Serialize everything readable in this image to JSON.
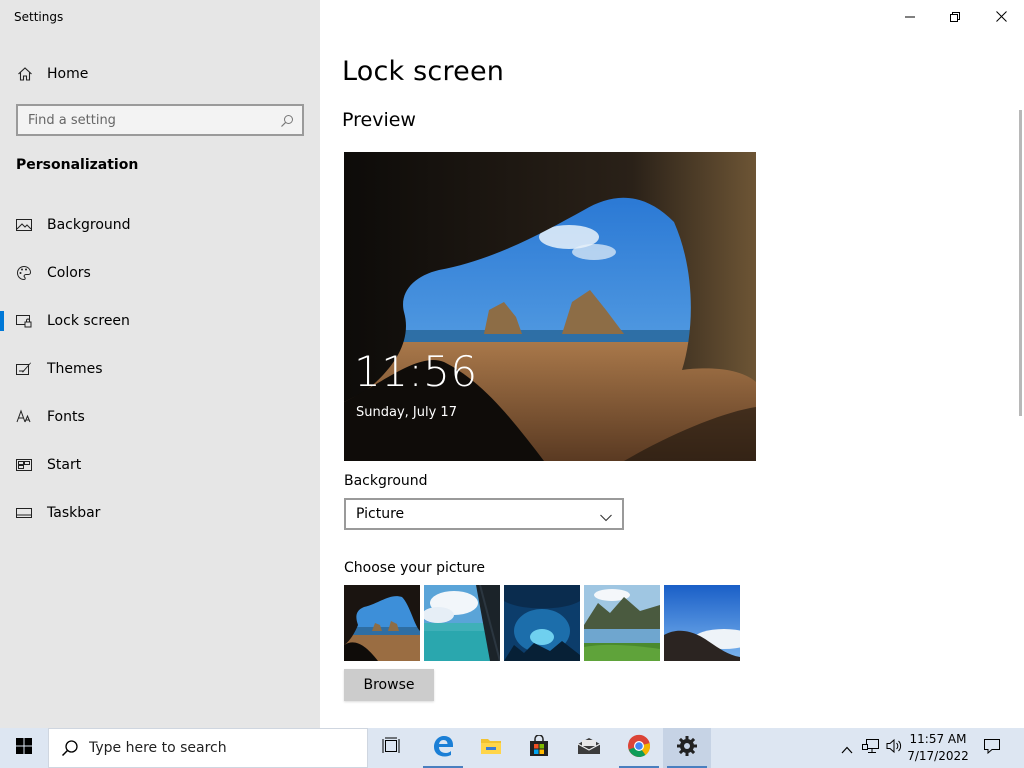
{
  "window": {
    "title": "Settings",
    "controls": {
      "minimize": "minimize-icon",
      "restore": "restore-icon",
      "close": "close-icon"
    }
  },
  "nav": {
    "home_label": "Home",
    "search_placeholder": "Find a setting",
    "section_header": "Personalization",
    "items": [
      {
        "label": "Background",
        "icon": "picture-icon"
      },
      {
        "label": "Colors",
        "icon": "palette-icon"
      },
      {
        "label": "Lock screen",
        "icon": "lock-screen-icon",
        "active": true
      },
      {
        "label": "Themes",
        "icon": "brush-icon"
      },
      {
        "label": "Fonts",
        "icon": "font-icon"
      },
      {
        "label": "Start",
        "icon": "start-tiles-icon"
      },
      {
        "label": "Taskbar",
        "icon": "taskbar-icon"
      }
    ]
  },
  "main": {
    "title": "Lock screen",
    "preview_header": "Preview",
    "preview_time": "11:56",
    "preview_date": "Sunday, July 17",
    "background_label": "Background",
    "background_value": "Picture",
    "choose_label": "Choose your picture",
    "thumbnails": [
      "cave-beach",
      "water-window",
      "underwater-cave",
      "mountain-lake",
      "cliff-sky"
    ],
    "browse_label": "Browse"
  },
  "taskbar": {
    "search_placeholder": "Type here to search",
    "apps": [
      "task-view",
      "edge",
      "file-explorer",
      "store",
      "mail",
      "chrome",
      "settings"
    ],
    "time": "11:57 AM",
    "date": "7/17/2022"
  },
  "colors": {
    "accent": "#0078d7",
    "nav_bg": "#e6e6e6",
    "taskbar_bg": "#dde6f2"
  }
}
